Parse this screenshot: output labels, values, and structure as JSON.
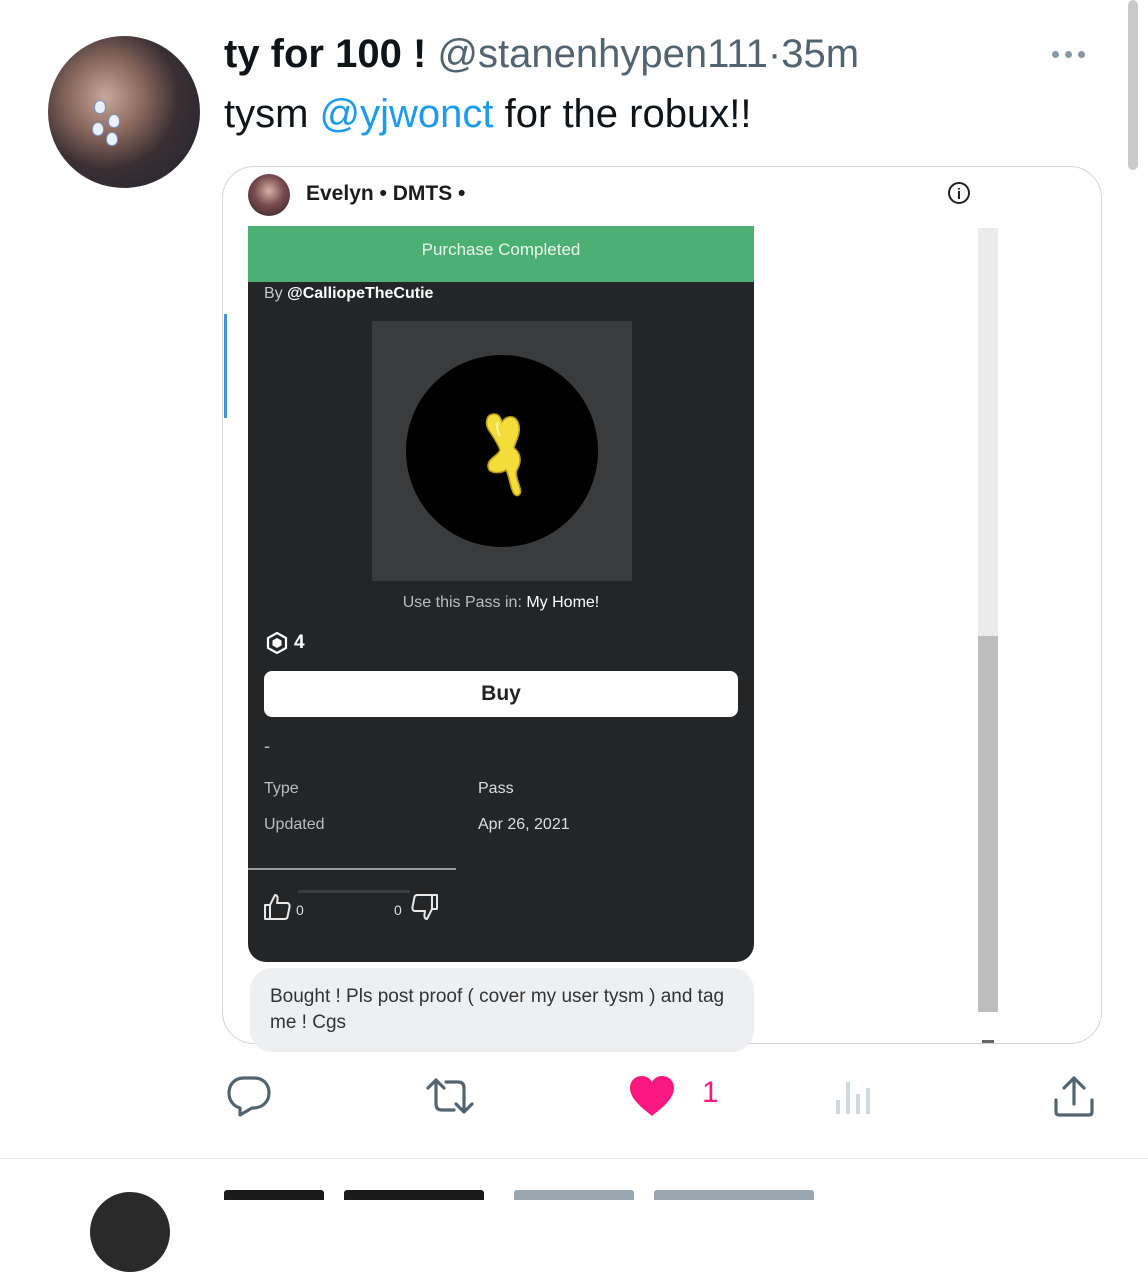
{
  "tweet": {
    "display_name": "ty for 100 !",
    "handle": "@stanenhypen111",
    "separator": "·",
    "time": "35m",
    "text_prefix": "tysm ",
    "mention": "@yjwonct",
    "text_suffix": " for the robux!!"
  },
  "media": {
    "chat_header": {
      "name": "Evelyn • DMTS •"
    },
    "roblox_item": {
      "banner": "Purchase Completed",
      "by_prefix": "By ",
      "creator": "@CalliopeTheCutie",
      "use_prefix": "Use this Pass in: ",
      "game": "My Home!",
      "price": "4",
      "buy_label": "Buy",
      "dash": "-",
      "type_label": "Type",
      "type_value": "Pass",
      "updated_label": "Updated",
      "updated_value": "Apr 26, 2021",
      "upvotes": "0",
      "downvotes": "0"
    },
    "chat_message": "Bought ! Pls post proof ( cover my user tysm ) and tag me ! Cgs"
  },
  "actions": {
    "like_count": "1"
  },
  "colors": {
    "accent": "#1d9bf0",
    "like": "#f91880",
    "purchase_green": "#4caf73",
    "panel_dark": "#232527"
  },
  "icons": [
    "more-icon",
    "info-icon",
    "robux-icon",
    "thumbs-up-icon",
    "thumbs-down-icon",
    "reply-icon",
    "retweet-icon",
    "heart-icon",
    "views-icon",
    "share-icon"
  ]
}
